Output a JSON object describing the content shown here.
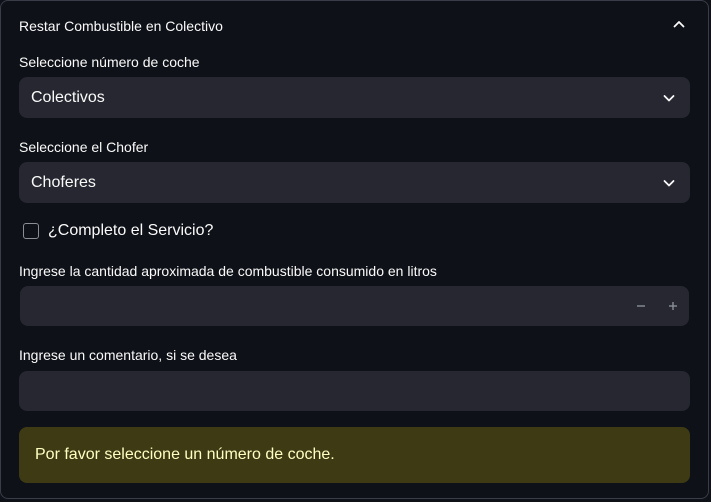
{
  "expander": {
    "title": "Restar Combustible en Colectivo",
    "chevron_icon": "chevron-up-icon"
  },
  "coche": {
    "label": "Seleccione número de coche",
    "selected": "Colectivos",
    "chevron_icon": "chevron-down-icon"
  },
  "chofer": {
    "label": "Seleccione el Chofer",
    "selected": "Choferes",
    "chevron_icon": "chevron-down-icon"
  },
  "servicio": {
    "label": "¿Completo el Servicio?",
    "checked": false
  },
  "combustible": {
    "label": "Ingrese la cantidad aproximada de combustible consumido en litros",
    "value": "",
    "decrement_icon": "minus-icon",
    "increment_icon": "plus-icon"
  },
  "comentario": {
    "label": "Ingrese un comentario, si se desea",
    "value": ""
  },
  "alert": {
    "message": "Por favor seleccione un número de coche.",
    "background": "#3d3a14",
    "text_color": "#ffffc2"
  },
  "colors": {
    "page_bg": "#0e1117",
    "input_bg": "#262730",
    "border": "#3a3d48",
    "text": "#fafafa"
  }
}
